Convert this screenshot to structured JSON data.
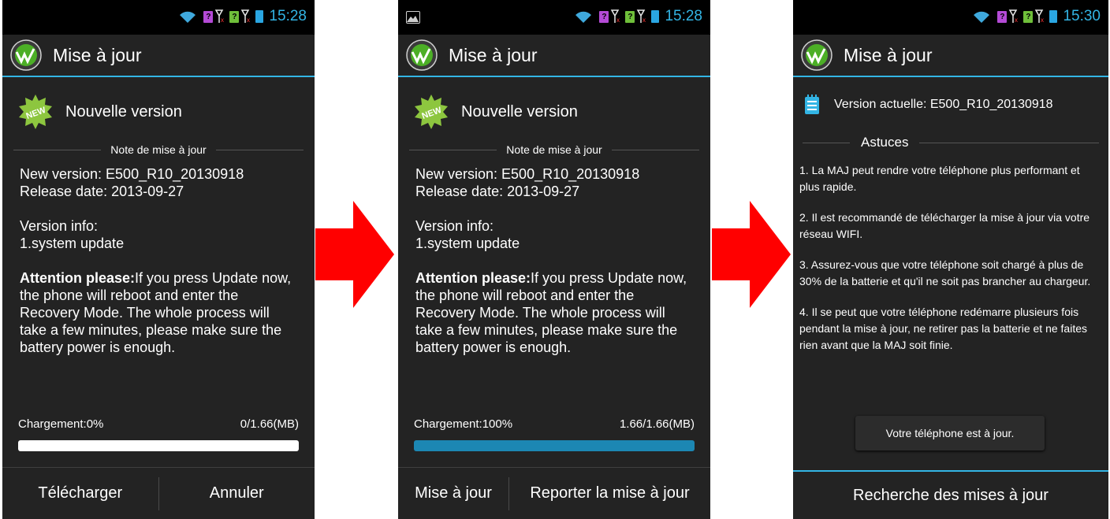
{
  "screens": [
    {
      "status_time": "15:28",
      "title": "Mise à jour",
      "new_version": "Nouvelle version",
      "notes_header": "Note de mise à jour",
      "new_version_line": "New version: E500_R10_20130918",
      "release_date": "Release date: 2013-09-27",
      "version_info_label": "Version info:",
      "version_info_item": "1.system update",
      "attention_bold": "Attention please:",
      "attention_text": "If you press Update now, the phone will reboot and enter the Recovery Mode. The whole process will take a few minutes, please make sure the battery power is enough.",
      "progress_label": "Chargement:0%",
      "progress_size": "0/1.66(MB)",
      "progress_fraction": 0,
      "btn_left": "Télécharger",
      "btn_right": "Annuler"
    },
    {
      "status_time": "15:28",
      "title": "Mise à jour",
      "new_version": "Nouvelle version",
      "notes_header": "Note de mise à jour",
      "new_version_line": "New version: E500_R10_20130918",
      "release_date": "Release date: 2013-09-27",
      "version_info_label": "Version info:",
      "version_info_item": "1.system update",
      "attention_bold": "Attention please:",
      "attention_text": "If you press Update now, the phone will reboot and enter the Recovery Mode. The whole process will take a few minutes, please make sure the battery power is enough.",
      "progress_label": "Chargement:100%",
      "progress_size": "1.66/1.66(MB)",
      "progress_fraction": 1,
      "btn_left": "Mise à jour",
      "btn_right": "Reporter la mise à jour"
    },
    {
      "status_time": "15:30",
      "title": "Mise à jour",
      "current_version": "Version actuelle: E500_R10_20130918",
      "tips_header": "Astuces",
      "tips": [
        "1. La MAJ peut rendre votre téléphone plus performant et plus rapide.",
        "2. Il est recommandé de télécharger la mise à jour via votre réseau WIFI.",
        "3. Assurez-vous que votre téléphone soit chargé à plus de 30% de la batterie et qu'il ne soit pas brancher au chargeur.",
        "4. Il se peut que votre téléphone redémarre plusieurs fois pendant la mise à jour, ne retirer pas la batterie et ne faites rien avant que la MAJ soit finie."
      ],
      "up_to_date": "Votre téléphone est à jour.",
      "bottom_button": "Recherche des mises à jour"
    }
  ],
  "sim_labels": [
    "?",
    "?"
  ],
  "icons": [
    "wifi-icon",
    "sim1-icon",
    "antenna-icon",
    "sim2-icon",
    "battery-icon",
    "app-icon",
    "new-badge-icon",
    "notepad-icon",
    "image-notification-icon",
    "arrow-icon"
  ],
  "colors": {
    "accent": "#33b5e5",
    "background": "#232323",
    "progress_empty": "#ffffff",
    "progress_full": "#1c87b3",
    "arrow": "#ff0000",
    "new_badge": "#8dc63f"
  }
}
